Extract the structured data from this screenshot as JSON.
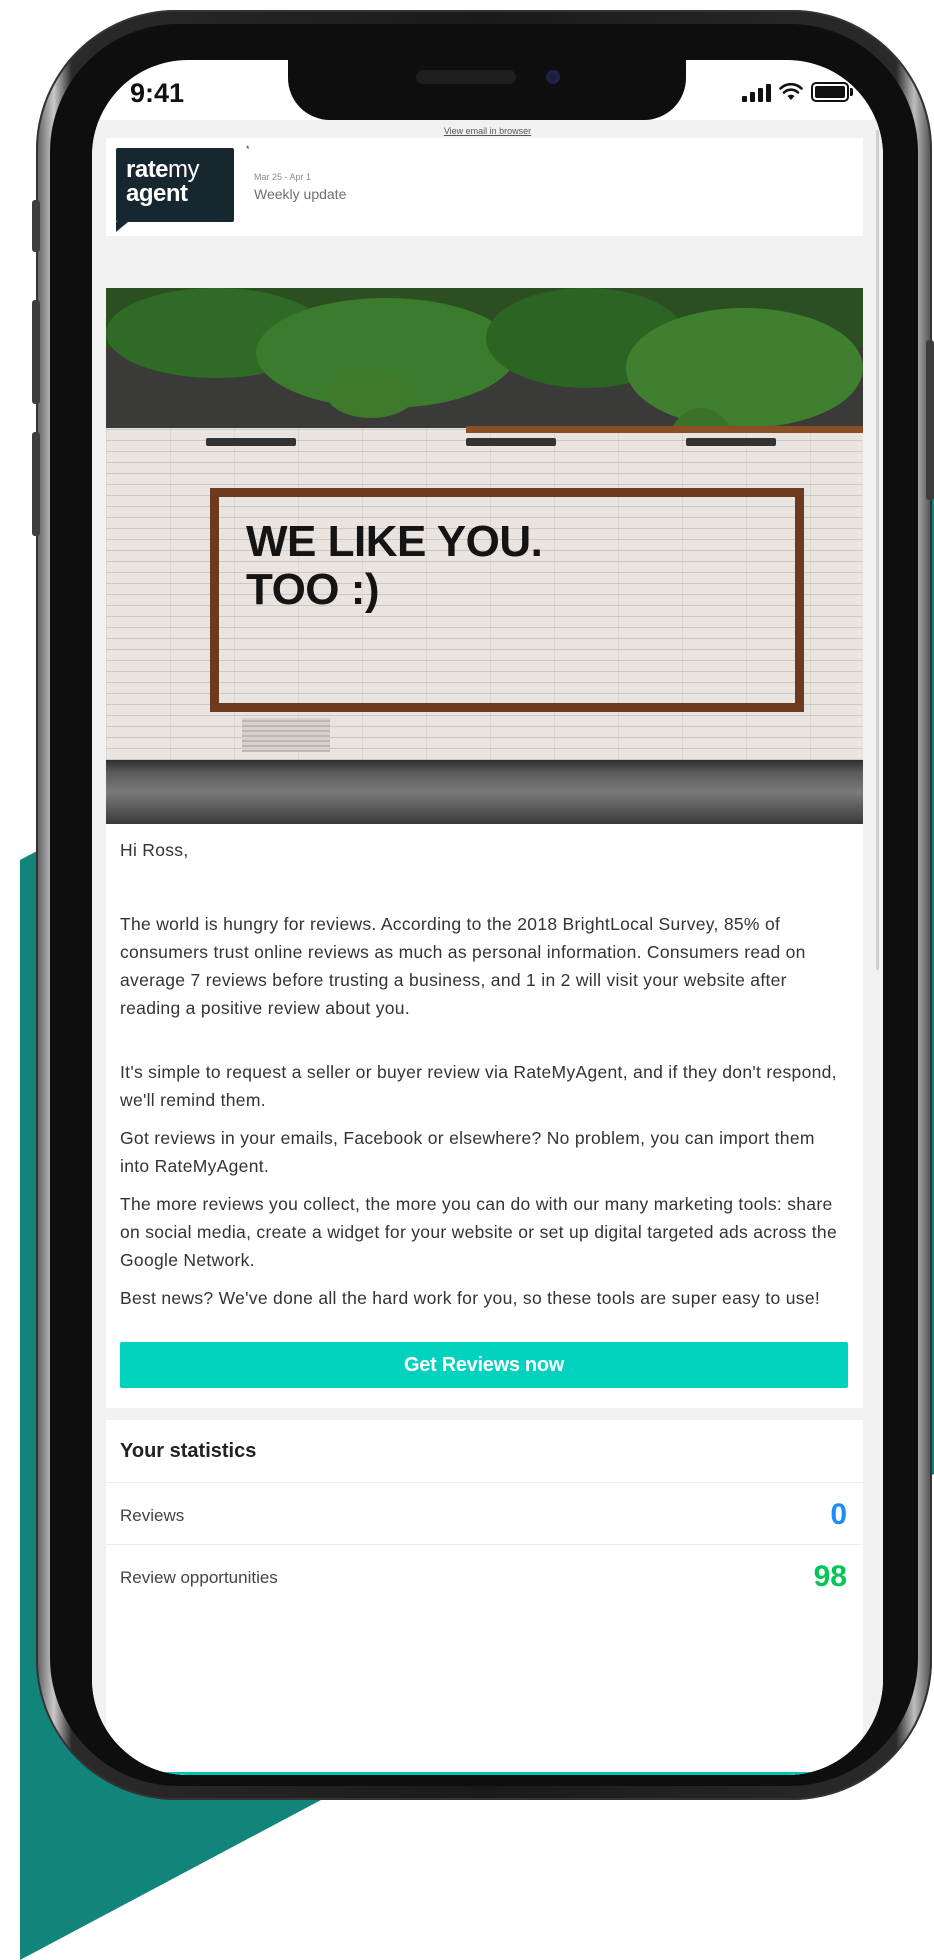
{
  "status_bar": {
    "time": "9:41"
  },
  "email": {
    "view_in_browser": "View email in browser",
    "logo": {
      "line1_bold": "rate",
      "line1_light": "my",
      "line2": "agent"
    },
    "header_mark": "*",
    "date_range": "Mar 25 - Apr 1",
    "subtitle": "Weekly update",
    "hero_text": {
      "line1": "WE LIKE YOU.",
      "line2": "TOO :)"
    },
    "greeting": "Hi Ross,",
    "paragraphs": [
      "The world is hungry for reviews. According to the 2018 BrightLocal Survey, 85% of consumers trust online reviews as much as personal information. Consumers read on average 7 reviews before trusting a business, and 1 in 2 will visit your website after reading a positive review about you.",
      "It's simple to request a seller or buyer review via RateMyAgent, and if they don't respond, we'll remind them.",
      "Got reviews in your emails, Facebook or elsewhere? No problem, you can import them into RateMyAgent.",
      "The more reviews you collect, the more you can do with our many marketing tools: share on social media, create a widget for your website or set up digital targeted ads across the Google Network.",
      "Best news? We've done all the hard work for you, so these tools are super easy to use!"
    ],
    "cta_label": "Get Reviews now",
    "stats": {
      "title": "Your statistics",
      "rows": [
        {
          "label": "Reviews",
          "value": "0",
          "color": "#1a8cff"
        },
        {
          "label": "Review opportunities",
          "value": "98",
          "color": "#00c853"
        }
      ]
    }
  },
  "colors": {
    "accent": "#00d2be",
    "brand_dark": "#17272f",
    "background_teal": "#12857a"
  },
  "icons": [
    "cellular-signal-icon",
    "wifi-icon",
    "battery-icon"
  ]
}
